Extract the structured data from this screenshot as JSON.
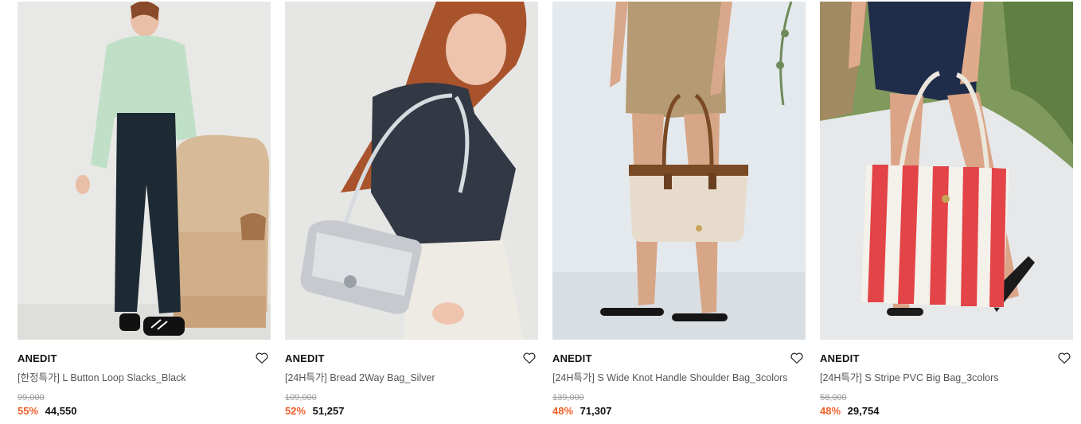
{
  "products": [
    {
      "brand": "ANEDIT",
      "name": "[한정특가] L Button Loop Slacks_Black",
      "original_price": "99,000",
      "discount": "55%",
      "sale_price": "44,550"
    },
    {
      "brand": "ANEDIT",
      "name": "[24H특가] Bread 2Way Bag_Silver",
      "original_price": "109,000",
      "discount": "52%",
      "sale_price": "51,257"
    },
    {
      "brand": "ANEDIT",
      "name": "[24H특가] S Wide Knot Handle Shoulder Bag_3colors",
      "original_price": "139,000",
      "discount": "48%",
      "sale_price": "71,307"
    },
    {
      "brand": "ANEDIT",
      "name": "[24H특가] S Stripe PVC Big Bag_3colors",
      "original_price": "58,000",
      "discount": "48%",
      "sale_price": "29,754"
    }
  ],
  "icons": {
    "wishlist": "heart-outline-icon"
  },
  "colors": {
    "discount": "#f0602a",
    "price": "#111111",
    "original_price": "#999999"
  }
}
